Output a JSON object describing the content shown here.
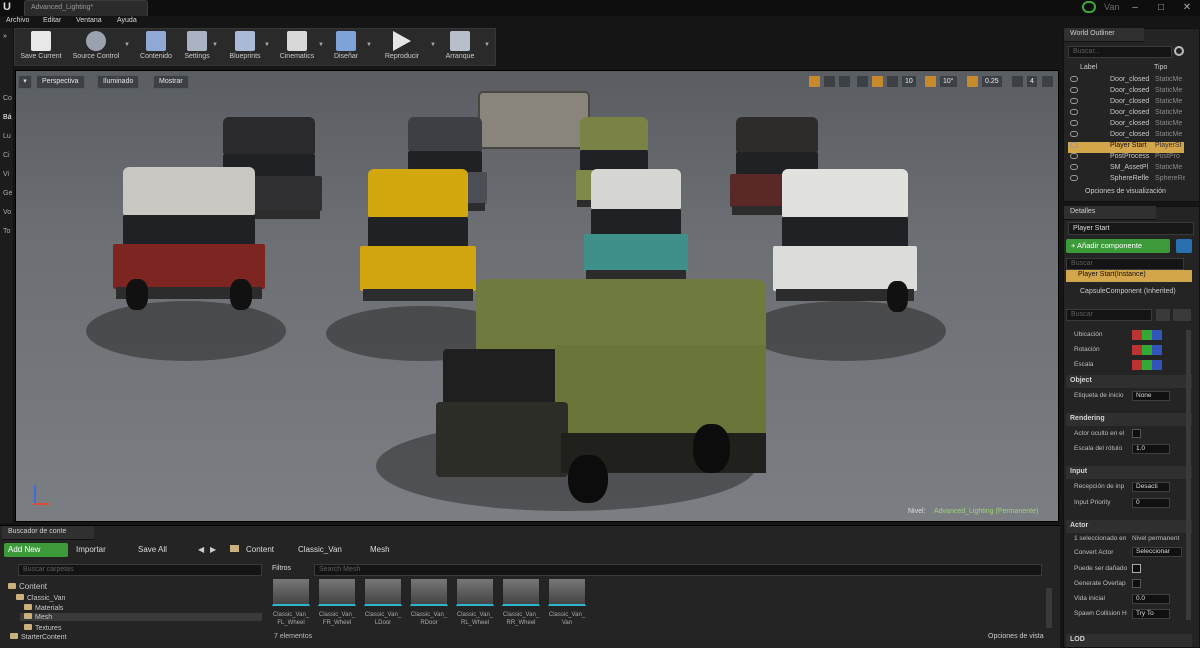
{
  "window": {
    "doc_tab": "Advanced_Lighting*",
    "user": "Van"
  },
  "menu": [
    "Archivo",
    "Editar",
    "Ventana",
    "Ayuda"
  ],
  "toolbar": [
    {
      "label": "Save Current",
      "icon": "save-icon"
    },
    {
      "label": "Source Control",
      "icon": "source-control-icon"
    },
    {
      "label": "Contenido",
      "icon": "content-icon"
    },
    {
      "label": "Settings",
      "icon": "settings-icon"
    },
    {
      "label": "Blueprints",
      "icon": "blueprints-icon"
    },
    {
      "label": "Cinematics",
      "icon": "cinematics-icon"
    },
    {
      "label": "Diseñar",
      "icon": "build-icon"
    },
    {
      "label": "Reproducir",
      "icon": "play-icon"
    },
    {
      "label": "Arranque",
      "icon": "launch-icon"
    }
  ],
  "left_strip": [
    "Co",
    "Bá",
    "Lu",
    "Ci",
    "Vi",
    "Ge",
    "Vo",
    "To"
  ],
  "viewport": {
    "buttons": [
      "Perspectiva",
      "Iluminado",
      "Mostrar"
    ],
    "grid_value": "10",
    "angle_value": "10°",
    "scale_value": "0.25",
    "camera_speed": "4",
    "level_prefix": "Nivel:",
    "level_name": "Advanced_Lighting (Permanente)"
  },
  "outliner": {
    "title": "World Outliner",
    "search_placeholder": "Buscar...",
    "col_label": "Label",
    "col_type": "Tipo",
    "rows": [
      {
        "label": "Door_closed",
        "type": "StaticMe"
      },
      {
        "label": "Door_closed",
        "type": "StaticMe"
      },
      {
        "label": "Door_closed",
        "type": "StaticMe"
      },
      {
        "label": "Door_closed",
        "type": "StaticMe"
      },
      {
        "label": "Door_closed",
        "type": "StaticMe"
      },
      {
        "label": "Door_closed",
        "type": "StaticMe"
      },
      {
        "label": "Player Start",
        "type": "PlayerSt"
      },
      {
        "label": "PostProcess",
        "type": "PostPro"
      },
      {
        "label": "SM_AssetPl",
        "type": "StaticMe"
      },
      {
        "label": "SphereRefle",
        "type": "SphereRe"
      }
    ],
    "footer": "Opciones de visualización"
  },
  "details": {
    "title": "Detalles",
    "object_name": "Player Start",
    "add_component": "+ Añadir componente",
    "search1": "Buscar",
    "instance": "Player Start(Instance)",
    "component": "CapsuleComponent (Inherited)",
    "search2": "Buscar",
    "transform": [
      "Ubicación",
      "Rotación",
      "Escala"
    ],
    "sections": [
      {
        "name": "Object",
        "props": [
          {
            "k": "Etiqueta de inicio",
            "v": "None"
          }
        ]
      },
      {
        "name": "Rendering",
        "props": [
          {
            "k": "Actor oculto en el",
            "v": ""
          },
          {
            "k": "Escala del rótulo",
            "v": "1.0"
          }
        ]
      },
      {
        "name": "Input",
        "props": [
          {
            "k": "Recepción de inp",
            "v": "Desacti"
          },
          {
            "k": "Input Priority",
            "v": "0"
          }
        ]
      },
      {
        "name": "Actor",
        "props": [
          {
            "k": "1 seleccionado en",
            "v": "Nivel permanent"
          },
          {
            "k": "Convert Actor",
            "v": "Seleccionar"
          },
          {
            "k": "Puede ser dañado",
            "v": ""
          },
          {
            "k": "Generate Overlap",
            "v": ""
          },
          {
            "k": "Vida inicial",
            "v": "0.0"
          },
          {
            "k": "Spawn Collision H",
            "v": "Try To"
          }
        ]
      }
    ],
    "lod": "LOD"
  },
  "content_browser": {
    "tab": "Buscador de conte",
    "add_new": "Add New",
    "import": "Importar",
    "save_all": "Save All",
    "path": [
      "Content",
      "Classic_Van",
      "Mesh"
    ],
    "folder_search": "Buscar carpetas",
    "filters": "Filtros",
    "mesh_search": "Search Mesh",
    "folders": [
      "Content",
      "Classic_Van",
      "Materials",
      "Mesh",
      "Textures",
      "StarterContent"
    ],
    "assets": [
      {
        "l1": "Classic_Van_",
        "l2": "FL_Wheel"
      },
      {
        "l1": "Classic_Van_",
        "l2": "FR_Wheel"
      },
      {
        "l1": "Classic_Van_",
        "l2": "LDoor"
      },
      {
        "l1": "Classic_Van_",
        "l2": "RDoor"
      },
      {
        "l1": "Classic_Van_",
        "l2": "RL_Wheel"
      },
      {
        "l1": "Classic_Van_",
        "l2": "RR_Wheel"
      },
      {
        "l1": "Classic_Van_",
        "l2": "Van"
      }
    ],
    "count": "7 elementos",
    "view_options": "Opciones de vista"
  }
}
